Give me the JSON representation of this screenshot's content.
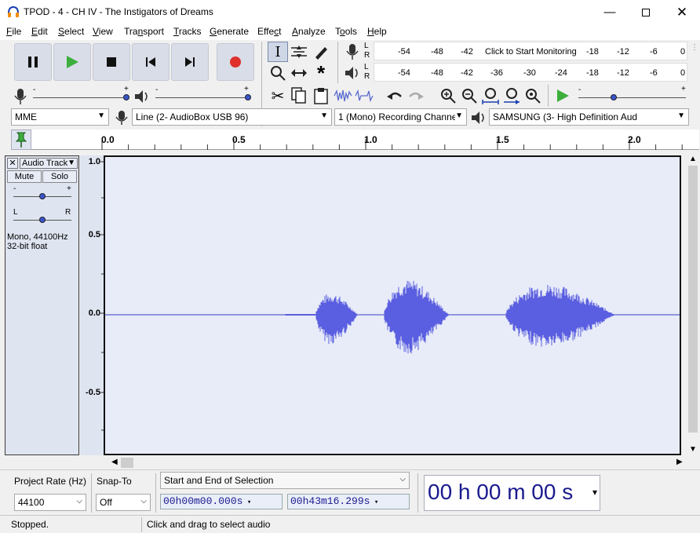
{
  "window": {
    "title": "TPOD - 4 - CH IV - The Instigators of Dreams"
  },
  "menu": [
    {
      "label": "File",
      "key": "F",
      "rest": "ile"
    },
    {
      "label": "Edit",
      "key": "E",
      "rest": "dit"
    },
    {
      "label": "Select",
      "key": "S",
      "rest": "elect"
    },
    {
      "label": "View",
      "key": "V",
      "rest": "iew"
    },
    {
      "label": "Transport",
      "pre": "Tra",
      "key": "n",
      "rest": "sport"
    },
    {
      "label": "Tracks",
      "key": "T",
      "rest": "racks"
    },
    {
      "label": "Generate",
      "key": "G",
      "rest": "enerate"
    },
    {
      "label": "Effect",
      "pre": "Effe",
      "key": "c",
      "rest": "t"
    },
    {
      "label": "Analyze",
      "key": "A",
      "rest": "nalyze"
    },
    {
      "label": "Tools",
      "pre": "T",
      "key": "o",
      "rest": "ols"
    },
    {
      "label": "Help",
      "key": "H",
      "rest": "elp"
    }
  ],
  "meters": {
    "record_ticks": [
      "-54",
      "-48",
      "-42",
      "Click to Start Monitoring",
      "-18",
      "-12",
      "-6",
      "0"
    ],
    "play_ticks": [
      "-54",
      "-48",
      "-42",
      "-36",
      "-30",
      "-24",
      "-18",
      "-12",
      "-6",
      "0"
    ],
    "channels": [
      "L",
      "R"
    ]
  },
  "sliders": {
    "minus": "-",
    "plus": "+"
  },
  "devices": {
    "host": "MME",
    "recording_device": "Line (2- AudioBox USB 96)",
    "channels": "1 (Mono) Recording Channe",
    "playback_device": "SAMSUNG (3- High Definition Aud"
  },
  "ruler": {
    "labels": [
      "0.0",
      "0.5",
      "1.0",
      "1.5",
      "2.0"
    ]
  },
  "track": {
    "name": "Audio Track",
    "mute": "Mute",
    "solo": "Solo",
    "gain_minus": "-",
    "gain_plus": "+",
    "pan_left": "L",
    "pan_right": "R",
    "info_line1": "Mono, 44100Hz",
    "info_line2": "32-bit float",
    "scale": [
      "1.0",
      "0.5",
      "0.0",
      "-0.5"
    ]
  },
  "waveform_color": "#5a5ee0",
  "bottom": {
    "project_rate_label": "Project Rate (Hz)",
    "project_rate_value": "44100",
    "snap_to_label": "Snap-To",
    "snap_to_value": "Off",
    "selection_mode": "Start and End of Selection",
    "sel_start": "00h00m00.000s",
    "sel_end": "00h43m16.299s",
    "big_time": "00 h 00 m 00 s"
  },
  "status": {
    "left": "Stopped.",
    "right": "Click and drag to select audio"
  }
}
